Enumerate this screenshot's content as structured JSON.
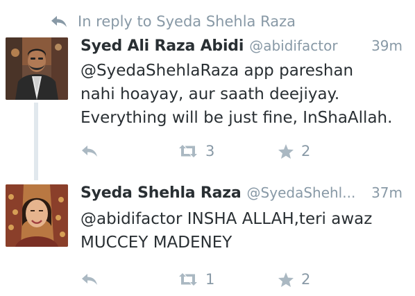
{
  "reply_context": {
    "text": "In reply to Syeda Shehla Raza",
    "icon": "reply-icon"
  },
  "tweets": [
    {
      "display_name": "Syed Ali Raza Abidi",
      "screen_name": "@abidifactor",
      "timestamp": "39m",
      "text_lines": [
        "@SyedaShehlaRaza app pareshan",
        "nahi hoayay, aur saath deejiyay.",
        "Everything will be just fine, InShaAllah."
      ],
      "retweet_count": "3",
      "favorite_count": "2"
    },
    {
      "display_name": "Syeda Shehla Raza",
      "screen_name": "@SyedaShehl...",
      "timestamp": "37m",
      "text_lines": [
        "@abidifactor INSHA ALLAH,teri awaz",
        "MUCCEY MADENEY"
      ],
      "retweet_count": "1",
      "favorite_count": "2"
    }
  ],
  "colors": {
    "meta_gray": "#8899a6",
    "icon_gray": "#aab8c2",
    "text_dark": "#292f33",
    "thread_line": "#e1e8ed"
  }
}
